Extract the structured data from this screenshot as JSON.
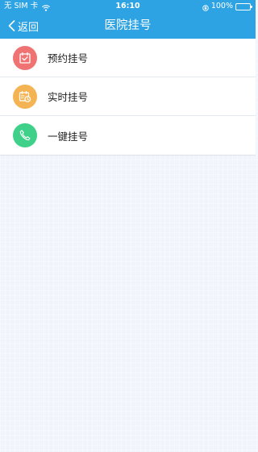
{
  "status_bar": {
    "carrier": "无 SIM 卡",
    "time": "16:10",
    "battery": "100%"
  },
  "nav": {
    "back_label": "返回",
    "title": "医院挂号"
  },
  "menu": [
    {
      "label": "预约挂号",
      "icon": "calendar-check-icon",
      "color": "#f07373"
    },
    {
      "label": "实时挂号",
      "icon": "calendar-clock-icon",
      "color": "#f4b453"
    },
    {
      "label": "一键挂号",
      "icon": "phone-icon",
      "color": "#3fd18a"
    }
  ],
  "colors": {
    "header": "#2ea3e3",
    "background": "#f0f5fb"
  }
}
